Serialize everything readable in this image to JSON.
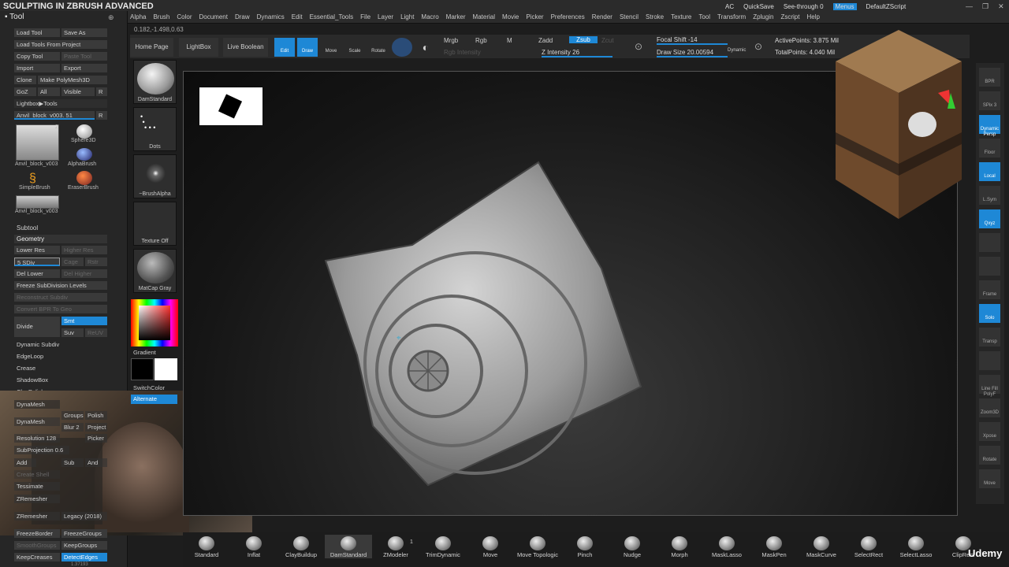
{
  "app": {
    "course_title": "SCULPTING IN ZBRUSH ADVANCED",
    "coords": "0.182,-1.498,0.63",
    "udemy": "Udemy"
  },
  "menu": [
    "Alpha",
    "Brush",
    "Color",
    "Document",
    "Draw",
    "Dynamics",
    "Edit",
    "Essential_Tools",
    "File",
    "Layer",
    "Light",
    "Macro",
    "Marker",
    "Material",
    "Movie",
    "Picker",
    "Preferences",
    "Render",
    "Stencil",
    "Stroke",
    "Texture",
    "Tool",
    "Transform",
    "Zplugin",
    "Zscript",
    "Help"
  ],
  "topright": {
    "ac": "AC",
    "quicksave": "QuickSave",
    "seethrough": "See-through",
    "seethrough_val": "0",
    "menus": "Menus",
    "defaultzscript": "DefaultZScript"
  },
  "tool": {
    "header": "Tool",
    "load_tool": "Load Tool",
    "save_as": "Save As",
    "load_from_project": "Load Tools From Project",
    "copy_tool": "Copy Tool",
    "paste_tool": "Paste Tool",
    "import": "Import",
    "export": "Export",
    "clone": "Clone",
    "make_polymesh": "Make PolyMesh3D",
    "goz": "GoZ",
    "all": "All",
    "visible": "Visible",
    "r": "R",
    "lightbox_tools": "Lightbox▶Tools",
    "current_tool": "Anvil_block_v003. 51",
    "r2": "R",
    "thumbs": [
      {
        "label": "Anvil_block_v003",
        "count": "2"
      },
      {
        "label": "Sphere3D"
      },
      {
        "label": "Anvil_block_v003"
      },
      {
        "label": "AlphaBrush"
      },
      {
        "label": "SimpleBrush"
      },
      {
        "label": "EraserBrush"
      },
      {
        "label": "Anvil_block_v003",
        "count": "2"
      }
    ],
    "subtool": "Subtool",
    "geometry": "Geometry",
    "lower_res": "Lower Res",
    "higher_res": "Higher Res",
    "sdiv": "5 SDiv",
    "cage": "Cage",
    "rstr": "Rstr",
    "del_lower": "Del Lower",
    "del_higher": "Del Higher",
    "freeze": "Freeze SubDivision Levels",
    "reconstruct": "Reconstruct Subdiv",
    "convert_bpr": "Convert BPR To Geo",
    "divide": "Divide",
    "smt": "Smt",
    "suv": "Suv",
    "reuv": "ReUV",
    "dynamic_subdiv": "Dynamic Subdiv",
    "edgeloop": "EdgeLoop",
    "crease": "Crease",
    "shadowbox": "ShadowBox",
    "claypolish": "ClayPolish",
    "dynamesh": "DynaMesh",
    "dynamesh2": "DynaMesh",
    "groups": "Groups",
    "polish": "Polish",
    "blur": "Blur 2",
    "project": "Project",
    "picker": "Picker",
    "resolution": "Resolution 128",
    "subprojection": "SubProjection 0.6",
    "add": "Add",
    "sub": "Sub",
    "and": "And",
    "create_shell": "Create Shell",
    "tessimate": "Tessimate",
    "zremesher": "ZRemesher",
    "legacy": "Legacy (2018)",
    "zremesher2": "ZRemesher",
    "freezeborder": "FreezeBorder",
    "freezegroups": "FreezeGroups",
    "smoothgroups": "SmoothGroups",
    "keepgroups": "KeepGroups",
    "keepcreases": "KeepCreases",
    "detectedges": "DetectEdges",
    "bottom_val": "1.37193"
  },
  "brushes": [
    {
      "label": "DamStandard"
    },
    {
      "label": "Dots"
    },
    {
      "label": "~BrushAlpha"
    },
    {
      "label": "Texture Off"
    },
    {
      "label": "MatCap Gray"
    }
  ],
  "color": {
    "gradient": "Gradient",
    "switchcolor": "SwitchColor",
    "alternate": "Alternate",
    "main": "#ff3030"
  },
  "toolbar": {
    "home": "Home Page",
    "lightbox": "LightBox",
    "liveboolean": "Live Boolean",
    "edit": "Edit",
    "draw": "Draw",
    "move": "Move",
    "scale": "Scale",
    "rotate": "Rotate",
    "mrgb": "Mrgb",
    "rgb": "Rgb",
    "m": "M",
    "rgb_intensity": "Rgb Intensity",
    "zadd": "Zadd",
    "zsub": "Zsub",
    "zcut": "Zcut",
    "z_intensity": "Z Intensity 26",
    "focal": "Focal Shift -14",
    "drawsize": "Draw Size 20.00594",
    "dynamic": "Dynamic",
    "active": "ActivePoints: 3.875 Mil",
    "total": "TotalPoints: 4.040 Mil"
  },
  "right": [
    "BPR",
    "SPix 3",
    "Dynamic Persp",
    "Floor",
    "Local",
    "L.Sym",
    "Qxyz",
    "",
    "",
    "Frame",
    "Solo",
    "Transp",
    "",
    "Line Fill PolyF",
    "Zoom3D",
    "Xpose",
    "Rotate",
    "Move"
  ],
  "bottom": [
    "Standard",
    "Inflat",
    "ClayBuildup",
    "DamStandard",
    "ZModeler",
    "TrimDynamic",
    "Move",
    "Move Topologic",
    "Pinch",
    "Nudge",
    "Morph",
    "MaskLasso",
    "MaskPen",
    "MaskCurve",
    "SelectRect",
    "SelectLasso",
    "ClipRect"
  ],
  "bottom_zmodeler_badge": "1"
}
